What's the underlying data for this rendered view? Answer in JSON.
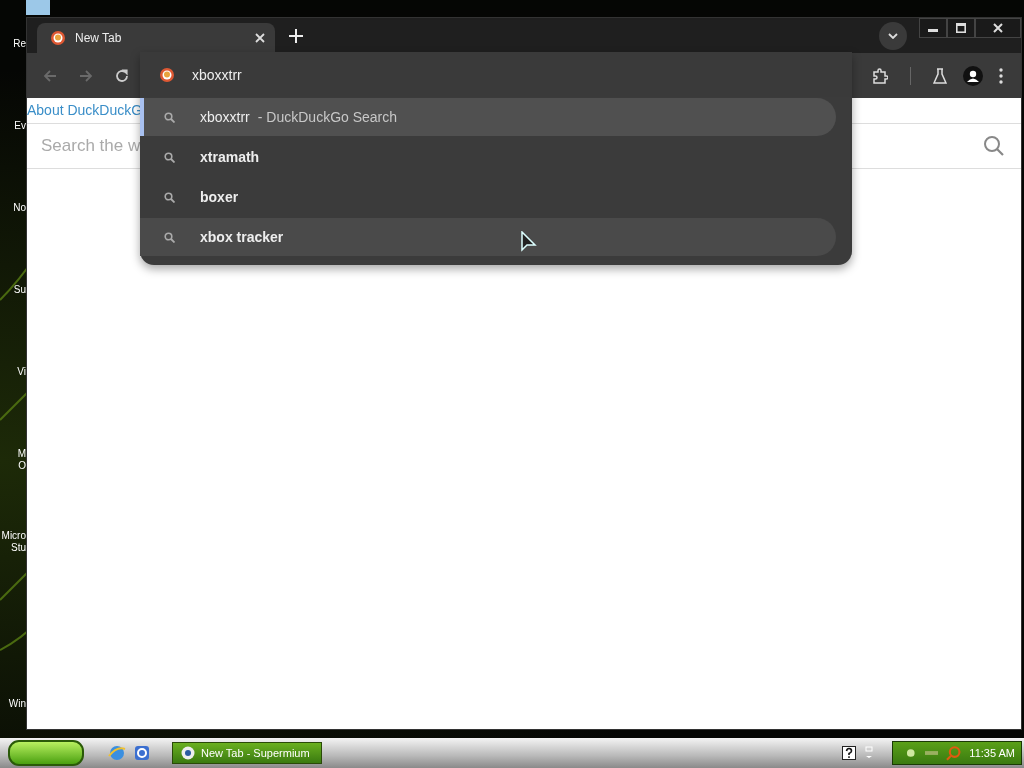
{
  "desktop": {
    "icon_labels": [
      {
        "lines": [
          "Re"
        ]
      },
      {
        "lines": [
          "Ev"
        ]
      },
      {
        "lines": [
          "No"
        ]
      },
      {
        "lines": [
          "Su"
        ]
      },
      {
        "lines": [
          "Vi"
        ]
      },
      {
        "lines": [
          "M",
          "O"
        ]
      },
      {
        "lines": [
          "Micro",
          "Stu"
        ]
      },
      {
        "lines": [
          "Win"
        ]
      }
    ]
  },
  "browser": {
    "tabs": [
      {
        "title": "New Tab",
        "selected": true
      }
    ],
    "toolbar": {
      "back_disabled": true,
      "forward_disabled": true
    },
    "address": {
      "value": "xboxxtrr"
    },
    "suggestions": [
      {
        "kind": "typed",
        "text": "xboxxtrr",
        "source": "- DuckDuckGo Search",
        "selected": true,
        "hovered": false
      },
      {
        "kind": "suggestion",
        "text": "xtramath",
        "selected": false,
        "hovered": false
      },
      {
        "kind": "suggestion",
        "text": "boxer",
        "selected": false,
        "hovered": false
      },
      {
        "kind": "suggestion",
        "text": "xbox tracker",
        "selected": false,
        "hovered": true
      }
    ],
    "page": {
      "link": "About DuckDuckG",
      "search": {
        "placeholder": "Search the w"
      }
    }
  },
  "taskbar": {
    "tasks": [
      {
        "title": "New Tab - Supermium",
        "selected": true
      }
    ],
    "clock": "11:35 AM"
  }
}
